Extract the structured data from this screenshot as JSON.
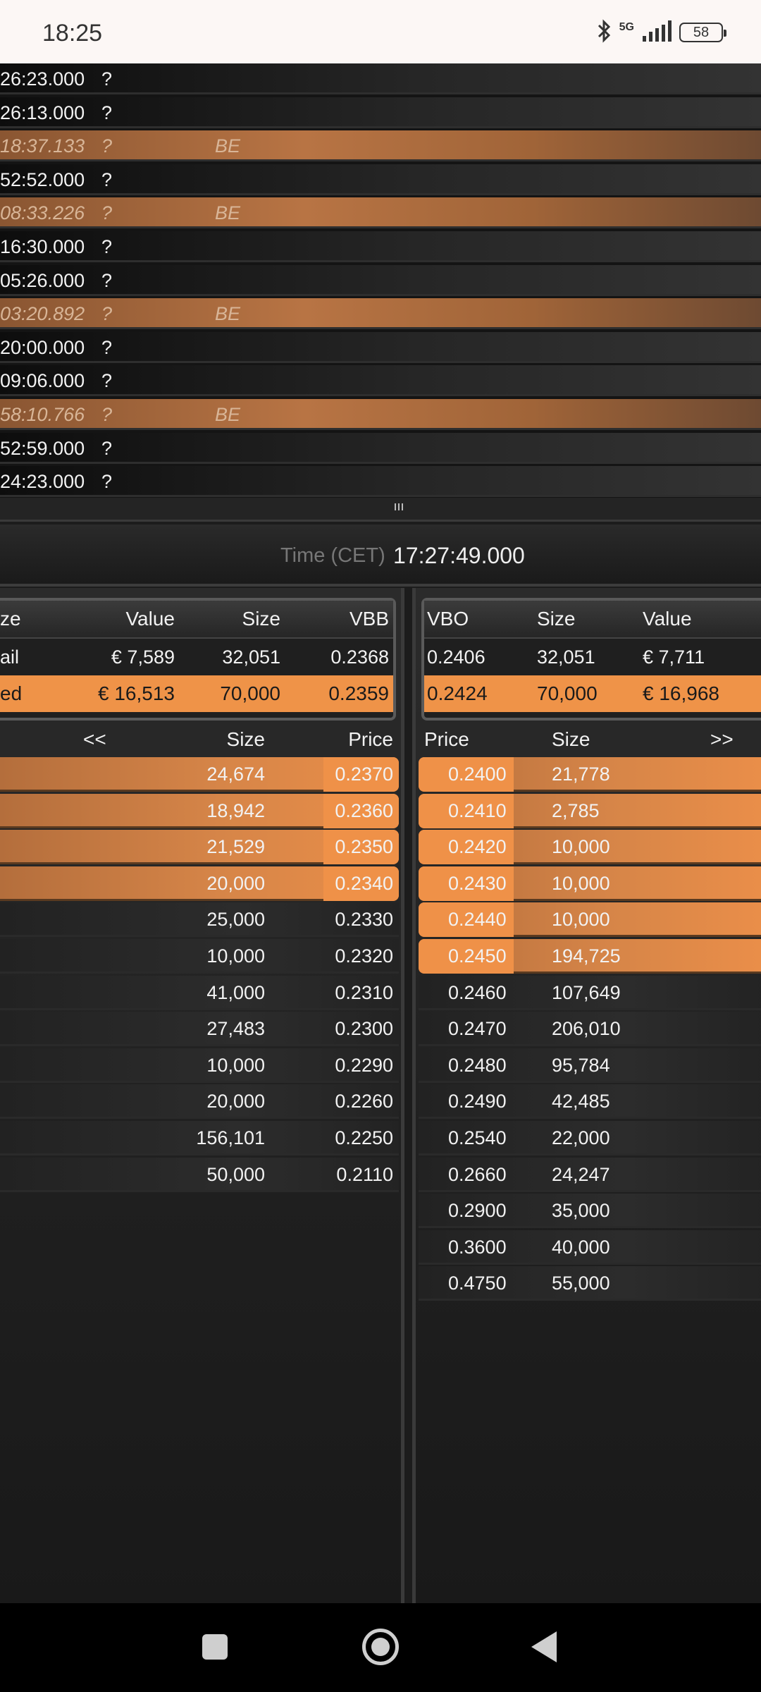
{
  "status_bar": {
    "time": "18:25",
    "network": "5G",
    "battery": "58",
    "bluetooth_icon": "bluetooth-icon",
    "signal_icon": "signal-icon"
  },
  "trades": [
    {
      "time": "26:23.000",
      "flag": "?",
      "tag": "",
      "highlight": false
    },
    {
      "time": "26:13.000",
      "flag": "?",
      "tag": "",
      "highlight": false
    },
    {
      "time": "18:37.133",
      "flag": "?",
      "tag": "BE",
      "highlight": true
    },
    {
      "time": "52:52.000",
      "flag": "?",
      "tag": "",
      "highlight": false
    },
    {
      "time": "08:33.226",
      "flag": "?",
      "tag": "BE",
      "highlight": true
    },
    {
      "time": "16:30.000",
      "flag": "?",
      "tag": "",
      "highlight": false
    },
    {
      "time": "05:26.000",
      "flag": "?",
      "tag": "",
      "highlight": false
    },
    {
      "time": "03:20.892",
      "flag": "?",
      "tag": "BE",
      "highlight": true
    },
    {
      "time": "20:00.000",
      "flag": "?",
      "tag": "",
      "highlight": false
    },
    {
      "time": "09:06.000",
      "flag": "?",
      "tag": "",
      "highlight": false
    },
    {
      "time": "58:10.766",
      "flag": "?",
      "tag": "BE",
      "highlight": true
    },
    {
      "time": "52:59.000",
      "flag": "?",
      "tag": "",
      "highlight": false
    },
    {
      "time": "24:23.000",
      "flag": "?",
      "tag": "",
      "highlight": false
    }
  ],
  "clock": {
    "label": "Time (CET)",
    "value": "17:27:49.000"
  },
  "bid_summary": {
    "headers": {
      "size_truncated": "ze",
      "value": "Value",
      "size": "Size",
      "vbb": "VBB"
    },
    "rows": [
      {
        "label": "ail",
        "value": "€ 7,589",
        "size": "32,051",
        "price": "0.2368",
        "highlight": false
      },
      {
        "label": "ed",
        "value": "€ 16,513",
        "size": "70,000",
        "price": "0.2359",
        "highlight": true
      }
    ]
  },
  "ask_summary": {
    "headers": {
      "vbo": "VBO",
      "size": "Size",
      "value": "Value"
    },
    "rows": [
      {
        "price": "0.2406",
        "size": "32,051",
        "value": "€ 7,711",
        "highlight": false
      },
      {
        "price": "0.2424",
        "size": "70,000",
        "value": "€ 16,968",
        "highlight": true
      }
    ]
  },
  "bid_book": {
    "headers": {
      "nav": "<<",
      "size": "Size",
      "price": "Price"
    },
    "rows": [
      {
        "size": "24,674",
        "price": "0.2370",
        "highlight": true
      },
      {
        "size": "18,942",
        "price": "0.2360",
        "highlight": true
      },
      {
        "size": "21,529",
        "price": "0.2350",
        "highlight": true
      },
      {
        "size": "20,000",
        "price": "0.2340",
        "highlight": true
      },
      {
        "size": "25,000",
        "price": "0.2330",
        "highlight": false
      },
      {
        "size": "10,000",
        "price": "0.2320",
        "highlight": false
      },
      {
        "size": "41,000",
        "price": "0.2310",
        "highlight": false
      },
      {
        "size": "27,483",
        "price": "0.2300",
        "highlight": false
      },
      {
        "size": "10,000",
        "price": "0.2290",
        "highlight": false
      },
      {
        "size": "20,000",
        "price": "0.2260",
        "highlight": false
      },
      {
        "size": "156,101",
        "price": "0.2250",
        "highlight": false
      },
      {
        "size": "50,000",
        "price": "0.2110",
        "highlight": false
      }
    ]
  },
  "ask_book": {
    "headers": {
      "price": "Price",
      "size": "Size",
      "nav": ">>"
    },
    "rows": [
      {
        "price": "0.2400",
        "size": "21,778",
        "highlight": true
      },
      {
        "price": "0.2410",
        "size": "2,785",
        "highlight": true
      },
      {
        "price": "0.2420",
        "size": "10,000",
        "highlight": true
      },
      {
        "price": "0.2430",
        "size": "10,000",
        "highlight": true
      },
      {
        "price": "0.2440",
        "size": "10,000",
        "highlight": true
      },
      {
        "price": "0.2450",
        "size": "194,725",
        "highlight": true
      },
      {
        "price": "0.2460",
        "size": "107,649",
        "highlight": false
      },
      {
        "price": "0.2470",
        "size": "206,010",
        "highlight": false
      },
      {
        "price": "0.2480",
        "size": "95,784",
        "highlight": false
      },
      {
        "price": "0.2490",
        "size": "42,485",
        "highlight": false
      },
      {
        "price": "0.2540",
        "size": "22,000",
        "highlight": false
      },
      {
        "price": "0.2660",
        "size": "24,247",
        "highlight": false
      },
      {
        "price": "0.2900",
        "size": "35,000",
        "highlight": false
      },
      {
        "price": "0.3600",
        "size": "40,000",
        "highlight": false
      },
      {
        "price": "0.4750",
        "size": "55,000",
        "highlight": false
      }
    ]
  },
  "colors": {
    "accent": "#ef9348",
    "background": "#1c1c1c",
    "status_bar": "#fcf7f5"
  }
}
